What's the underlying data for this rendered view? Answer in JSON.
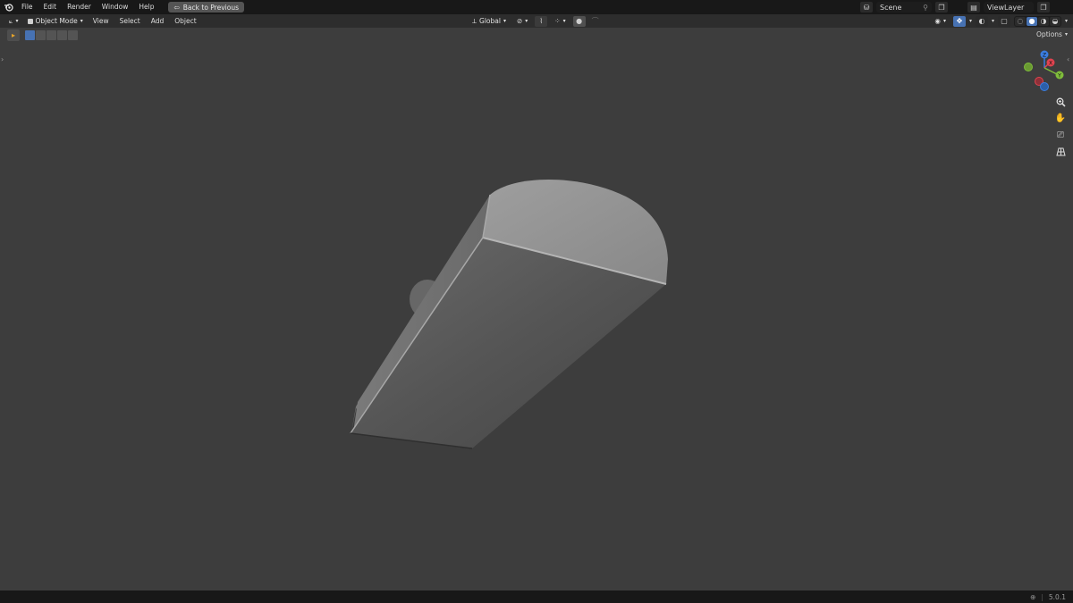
{
  "topbar": {
    "menus": [
      "File",
      "Edit",
      "Render",
      "Window",
      "Help"
    ],
    "back_button": "Back to Previous",
    "scene": "Scene",
    "view_layer": "ViewLayer"
  },
  "header": {
    "mode": "Object Mode",
    "menus": [
      "View",
      "Select",
      "Add",
      "Object"
    ],
    "orientation": "Global"
  },
  "options_label": "Options",
  "gizmo_axes": {
    "x": "X",
    "y": "Y",
    "z": "Z"
  },
  "statusbar": {
    "version": "5.0.1"
  },
  "colors": {
    "accent": "#4772b3",
    "x_axis": "#e0434f",
    "y_axis": "#7fbd3b",
    "z_axis": "#3a7de0"
  }
}
